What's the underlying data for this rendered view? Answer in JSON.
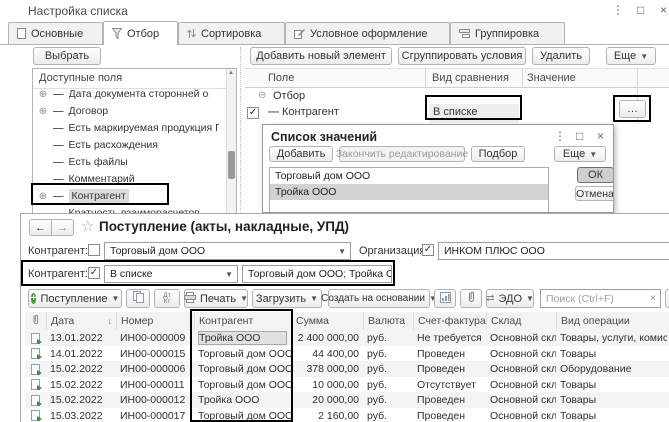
{
  "colors": {
    "highlight_box": "#000000",
    "accent_green": "#3d9b3d",
    "selection_gray": "#d4d4d4"
  },
  "settings_window": {
    "title": "Настройка списка",
    "controls": {
      "more": "⋮",
      "maximize": "□",
      "close": "×"
    },
    "tabs": [
      {
        "label": "Основные"
      },
      {
        "label": "Отбор"
      },
      {
        "label": "Сортировка"
      },
      {
        "label": "Условное оформление"
      },
      {
        "label": "Группировка"
      }
    ],
    "select_button": "Выбрать",
    "toolbar": {
      "add_new": "Добавить новый элемент",
      "group_conditions": "Сгруппировать условия",
      "delete": "Удалить",
      "more": "Еще"
    },
    "available_fields": {
      "header": "Доступные поля",
      "items": [
        {
          "label": "Дата документа сторонней организаци"
        },
        {
          "label": "Договор"
        },
        {
          "label": "Есть маркируемая продукция ГИСМ"
        },
        {
          "label": "Есть расхождения"
        },
        {
          "label": "Есть файлы"
        },
        {
          "label": "Комментарий"
        },
        {
          "label": "Контрагент"
        },
        {
          "label": "Кратность взаиморасчетов"
        }
      ]
    },
    "filter_table": {
      "columns": [
        "Поле",
        "Вид сравнения",
        "Значение"
      ],
      "group_label": "Отбор",
      "row": {
        "field": "Контрагент",
        "comparison": "В списке",
        "ellipsis": "…"
      }
    }
  },
  "values_dialog": {
    "title": "Список значений",
    "controls": {
      "more": "⋮",
      "maximize": "□",
      "close": "×"
    },
    "buttons": {
      "add": "Добавить",
      "finish_edit": "Закончить редактирование",
      "pick": "Подбор",
      "more": "Еще",
      "ok": "ОК",
      "cancel": "Отмена"
    },
    "items": [
      {
        "label": "Торговый дом ООО"
      },
      {
        "label": "Тройка ООО"
      }
    ]
  },
  "list_window": {
    "title": "Поступление (акты, накладные, УПД)",
    "nav": {
      "back": "←",
      "forward": "→",
      "star": "☆"
    },
    "filters": {
      "counterparty_top": {
        "label": "Контрагент:",
        "value": "Торговый дом ООО"
      },
      "organization": {
        "label": "Организация:",
        "value": "ИНКОМ ПЛЮС ООО"
      },
      "counterparty_active": {
        "label": "Контрагент:",
        "comparison": "В списке",
        "value": "Торговый дом ООО; Тройка ООО"
      }
    },
    "toolbar": {
      "new_document": "Поступление",
      "dtkt_top": "Дт",
      "dtkt_bottom": "Кт",
      "print": "Печать",
      "load": "Загрузить",
      "create_based_on": "Создать на основании",
      "edo": "ЭДО",
      "search_placeholder": "Поиск (Ctrl+F)",
      "search_clear": "×"
    },
    "table": {
      "columns": [
        "Дата",
        "Номер",
        "Контрагент",
        "Сумма",
        "Валюта",
        "Счет-фактура",
        "Склад",
        "Вид операции"
      ],
      "sort_icon": "↓",
      "rows": [
        {
          "date": "13.01.2022",
          "number": "ИН00-000009",
          "counterparty": "Тройка ООО",
          "sum": "2 400 000,00",
          "currency": "руб.",
          "invoice": "Не требуется",
          "warehouse": "Основной склад",
          "operation": "Товары, услуги, комиссия"
        },
        {
          "date": "14.01.2022",
          "number": "ИН00-000015",
          "counterparty": "Торговый дом ООО",
          "sum": "44 400,00",
          "currency": "руб.",
          "invoice": "Проведен",
          "warehouse": "Основной склад",
          "operation": "Товары"
        },
        {
          "date": "15.02.2022",
          "number": "ИН00-000006",
          "counterparty": "Торговый дом ООО",
          "sum": "378 000,00",
          "currency": "руб.",
          "invoice": "Проведен",
          "warehouse": "Основной склад",
          "operation": "Оборудование"
        },
        {
          "date": "15.02.2022",
          "number": "ИН00-000011",
          "counterparty": "Торговый дом ООО",
          "sum": "10 000,00",
          "currency": "руб.",
          "invoice": "Отсутствует",
          "warehouse": "Основной склад",
          "operation": "Товары"
        },
        {
          "date": "15.02.2022",
          "number": "ИН00-000012",
          "counterparty": "Тройка ООО",
          "sum": "20 000,00",
          "currency": "руб.",
          "invoice": "Проведен",
          "warehouse": "Основной склад",
          "operation": "Товары"
        },
        {
          "date": "15.03.2022",
          "number": "ИН00-000017",
          "counterparty": "Торговый дом ООО",
          "sum": "2 160,00",
          "currency": "руб.",
          "invoice": "Проведен",
          "warehouse": "Основной склад",
          "operation": "Товары"
        }
      ]
    }
  }
}
